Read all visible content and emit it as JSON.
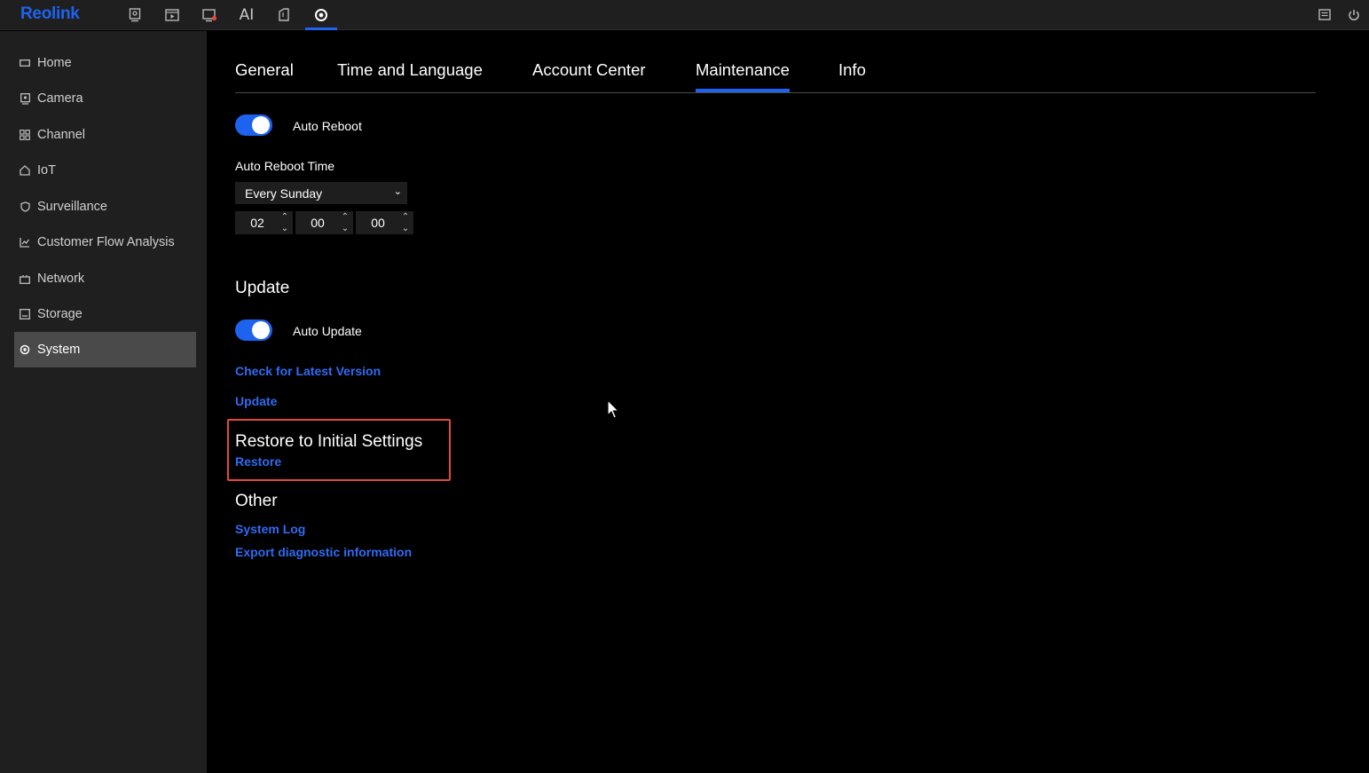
{
  "app": {
    "logo": "Reolink"
  },
  "topbar": {
    "icons": [
      "camera-monitor-icon",
      "playback-icon",
      "alarm-icon",
      "ai-icon",
      "files-icon",
      "settings-icon"
    ],
    "ai_label": "AI",
    "right_icons": [
      "message-icon",
      "power-icon"
    ]
  },
  "sidebar": {
    "items": [
      {
        "label": "Home",
        "icon": "home-icon"
      },
      {
        "label": "Camera",
        "icon": "camera-icon"
      },
      {
        "label": "Channel",
        "icon": "channel-icon"
      },
      {
        "label": "IoT",
        "icon": "iot-icon"
      },
      {
        "label": "Surveillance",
        "icon": "shield-icon"
      },
      {
        "label": "Customer Flow Analysis",
        "icon": "chart-icon"
      },
      {
        "label": "Network",
        "icon": "network-icon"
      },
      {
        "label": "Storage",
        "icon": "storage-icon"
      },
      {
        "label": "System",
        "icon": "system-gear-icon",
        "active": true
      }
    ]
  },
  "tabs": [
    {
      "label": "General"
    },
    {
      "label": "Time and Language"
    },
    {
      "label": "Account Center"
    },
    {
      "label": "Maintenance",
      "active": true
    },
    {
      "label": "Info"
    }
  ],
  "maintenance": {
    "auto_reboot_label": "Auto Reboot",
    "auto_reboot_enabled": true,
    "auto_reboot_time_label": "Auto Reboot Time",
    "schedule_value": "Every Sunday",
    "hour": "02",
    "minute": "00",
    "second": "00"
  },
  "update": {
    "title": "Update",
    "auto_update_label": "Auto Update",
    "auto_update_enabled": true,
    "check_link": "Check for Latest Version",
    "update_link": "Update"
  },
  "restore": {
    "title": "Restore to Initial Settings",
    "link": "Restore"
  },
  "other": {
    "title": "Other",
    "system_log_link": "System Log",
    "export_link": "Export diagnostic information"
  },
  "colors": {
    "accent": "#1e63f0",
    "link": "#2f6bf2",
    "highlight": "#e5483b",
    "panel": "#1f1f1f"
  }
}
